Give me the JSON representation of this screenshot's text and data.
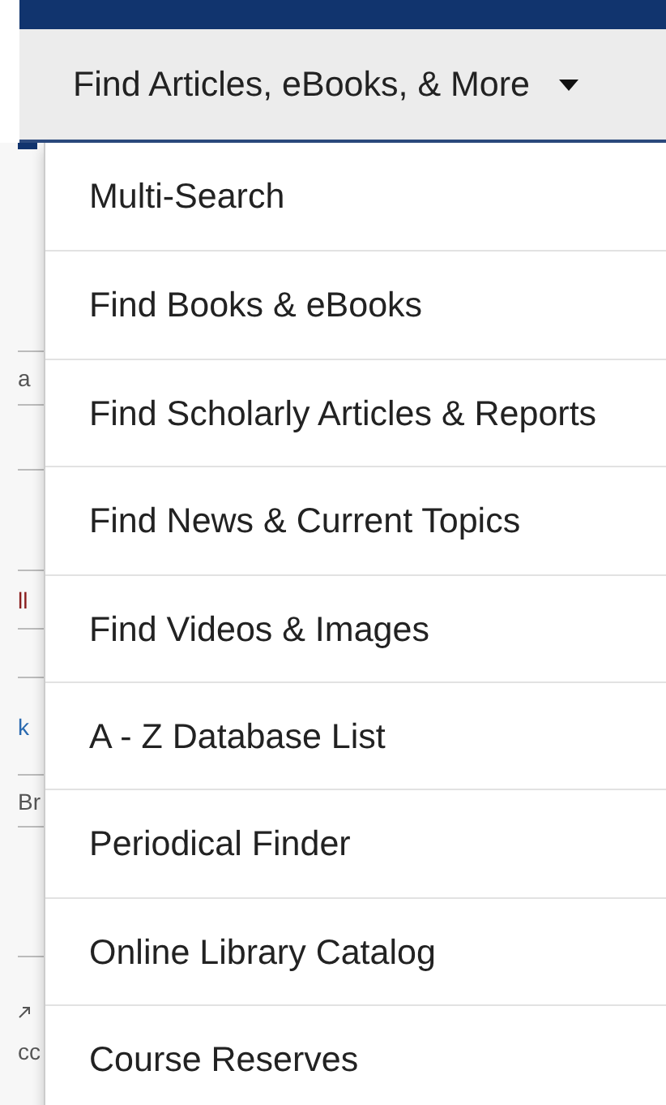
{
  "nav_button": {
    "label": "Find Articles, eBooks, & More",
    "expanded": true
  },
  "menu": {
    "items": [
      {
        "label": "Multi-Search"
      },
      {
        "label": "Find Books & eBooks"
      },
      {
        "label": "Find Scholarly Articles & Reports"
      },
      {
        "label": "Find News & Current Topics"
      },
      {
        "label": "Find Videos & Images"
      },
      {
        "label": "A - Z Database List"
      },
      {
        "label": "Periodical Finder"
      },
      {
        "label": "Online Library Catalog"
      },
      {
        "label": "Course Reserves"
      }
    ]
  },
  "background_fragments": [
    {
      "text": "a",
      "kind": "plain"
    },
    {
      "text": "ll",
      "kind": "accent"
    },
    {
      "text": "k",
      "kind": "link"
    },
    {
      "text": "Br",
      "kind": "plain"
    },
    {
      "text": "cc",
      "kind": "plain"
    }
  ]
}
